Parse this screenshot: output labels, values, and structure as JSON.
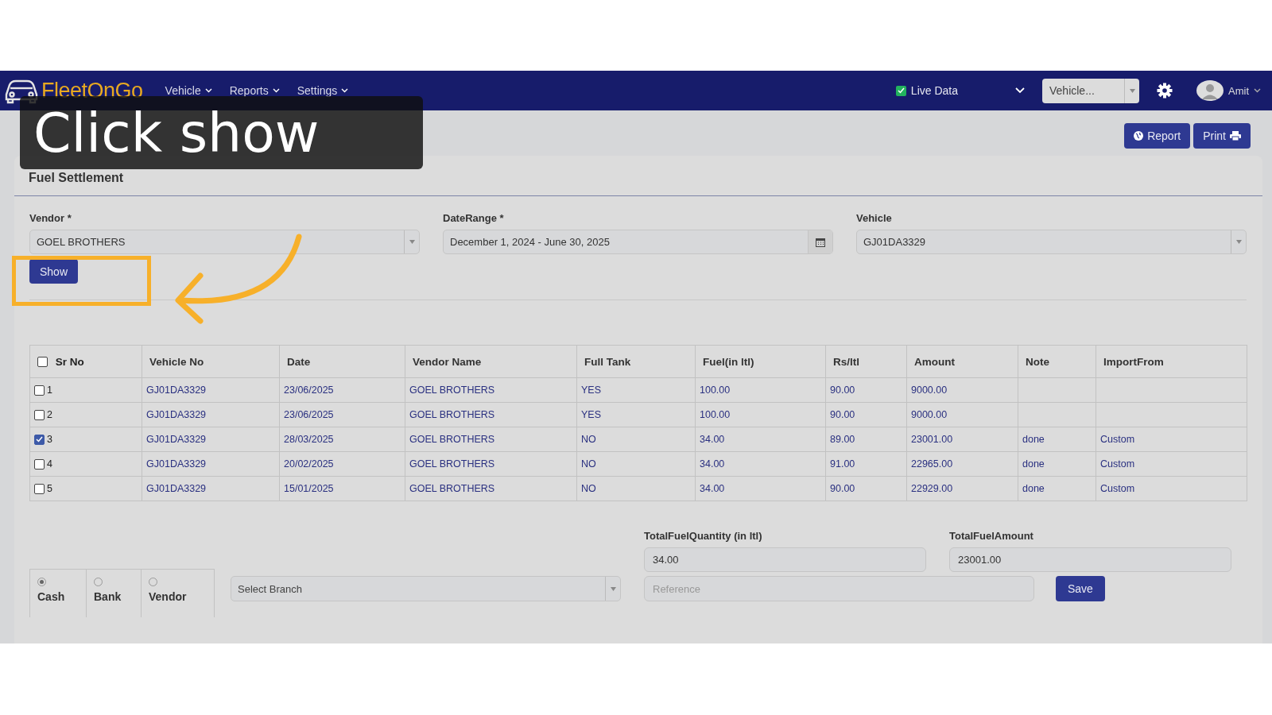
{
  "nav": {
    "logo": "FleetOnGo",
    "menus": [
      {
        "label": "Vehicle"
      },
      {
        "label": "Reports"
      },
      {
        "label": "Settings"
      }
    ],
    "live_data": {
      "label": "Live Data",
      "checked": true
    },
    "vehicle_select": {
      "value": "Vehicle..."
    },
    "user": {
      "name": "Amit"
    }
  },
  "actions": [
    {
      "label": "Report",
      "kind": "report"
    },
    {
      "label": "Print",
      "kind": "print"
    }
  ],
  "card": {
    "title": "Fuel Settlement"
  },
  "filters": [
    {
      "label": "Vendor *",
      "value": "GOEL BROTHERS",
      "kind": "select"
    },
    {
      "label": "DateRange *",
      "value": "December 1, 2024 - June 30, 2025",
      "kind": "date"
    },
    {
      "label": "Vehicle",
      "value": "GJ01DA3329",
      "kind": "select"
    }
  ],
  "show_button": "Show",
  "table": {
    "columns": [
      "Sr No",
      "Vehicle No",
      "Date",
      "Vendor Name",
      "Full Tank",
      "Fuel(in ltl)",
      "Rs/ltl",
      "Amount",
      "Note",
      "ImportFrom"
    ],
    "header_checked": false,
    "rows": [
      {
        "checked": false,
        "cells": [
          "1",
          "GJ01DA3329",
          "23/06/2025",
          "GOEL BROTHERS",
          "YES",
          "100.00",
          "90.00",
          "9000.00",
          "",
          ""
        ]
      },
      {
        "checked": false,
        "cells": [
          "2",
          "GJ01DA3329",
          "23/06/2025",
          "GOEL BROTHERS",
          "YES",
          "100.00",
          "90.00",
          "9000.00",
          "",
          ""
        ]
      },
      {
        "checked": true,
        "cells": [
          "3",
          "GJ01DA3329",
          "28/03/2025",
          "GOEL BROTHERS",
          "NO",
          "34.00",
          "89.00",
          "23001.00",
          "done",
          "Custom"
        ]
      },
      {
        "checked": false,
        "cells": [
          "4",
          "GJ01DA3329",
          "20/02/2025",
          "GOEL BROTHERS",
          "NO",
          "34.00",
          "91.00",
          "22965.00",
          "done",
          "Custom"
        ]
      },
      {
        "checked": false,
        "cells": [
          "5",
          "GJ01DA3329",
          "15/01/2025",
          "GOEL BROTHERS",
          "NO",
          "34.00",
          "90.00",
          "22929.00",
          "done",
          "Custom"
        ]
      }
    ]
  },
  "totals": [
    {
      "label": "TotalFuelQuantity (in ltl)",
      "value": "34.00"
    },
    {
      "label": "TotalFuelAmount",
      "value": "23001.00"
    }
  ],
  "branch_select": {
    "placeholder": "Select Branch"
  },
  "reference": {
    "placeholder": "Reference"
  },
  "save_button": "Save",
  "payment_modes": [
    {
      "label": "Cash",
      "selected": true
    },
    {
      "label": "Bank",
      "selected": false
    },
    {
      "label": "Vendor",
      "selected": false
    }
  ],
  "callout": {
    "text": "Click show"
  }
}
